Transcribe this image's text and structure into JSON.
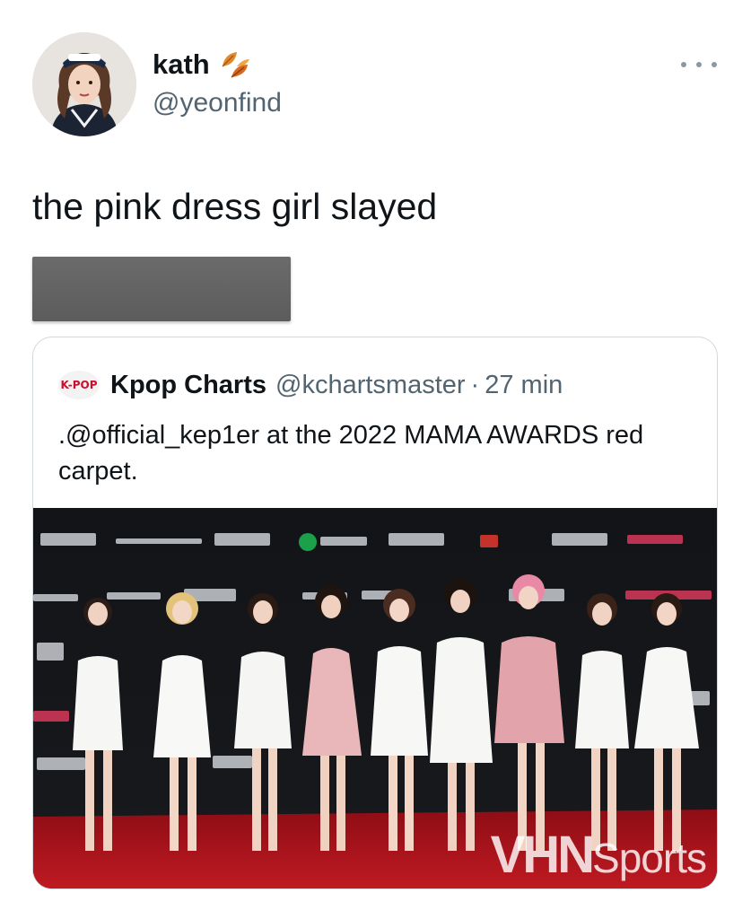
{
  "author": {
    "display_name": "kath",
    "handle": "@yeonfind",
    "name_emoji": "leaf-fall-icon"
  },
  "tweet": {
    "text": "the pink dress girl slayed"
  },
  "quoted_tweet": {
    "avatar_text": "K-POP",
    "display_name": "Kpop Charts",
    "handle": "@kchartsmaster",
    "separator": "·",
    "time": "27 min",
    "text": ".@official_kep1er at the 2022 MAMA AWARDS red carpet.",
    "image": {
      "watermark_bold": "VHN",
      "watermark_light": "Sports"
    }
  },
  "colors": {
    "text_primary": "#0f1419",
    "text_secondary": "#536471",
    "card_border": "#cfd9de",
    "redaction": "#5f5f5f",
    "carpet_red": "#b3121b"
  }
}
